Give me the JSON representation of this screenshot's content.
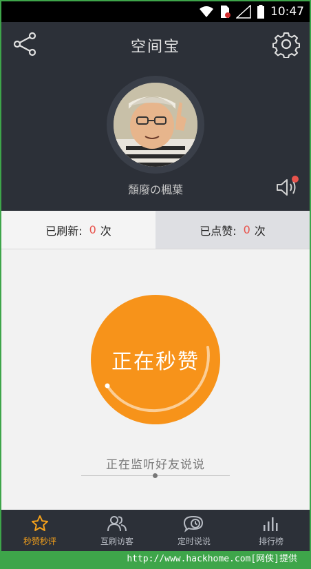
{
  "status_bar": {
    "time": "10:47"
  },
  "header": {
    "title": "空间宝",
    "username": "頹廢の楓葉"
  },
  "stats": {
    "refreshed_label": "已刷新:",
    "refreshed_count": "0",
    "refreshed_unit": "次",
    "liked_label": "已点赞:",
    "liked_count": "0",
    "liked_unit": "次"
  },
  "main": {
    "action_label": "正在秒赞",
    "status_text": "正在监听好友说说"
  },
  "nav": {
    "items": [
      {
        "label": "秒赞秒评",
        "icon": "star-icon",
        "active": true
      },
      {
        "label": "互刷访客",
        "icon": "people-icon",
        "active": false
      },
      {
        "label": "定时说说",
        "icon": "clock-bubble-icon",
        "active": false
      },
      {
        "label": "排行榜",
        "icon": "bar-chart-icon",
        "active": false
      }
    ]
  },
  "footer": {
    "watermark": "http://www.hackhome.com[网侠]提供"
  },
  "colors": {
    "header_bg": "#2c3038",
    "accent_orange": "#f7931a",
    "count_red": "#e8534c",
    "active_nav": "#f7a21b",
    "border_green": "#3ea54a"
  }
}
